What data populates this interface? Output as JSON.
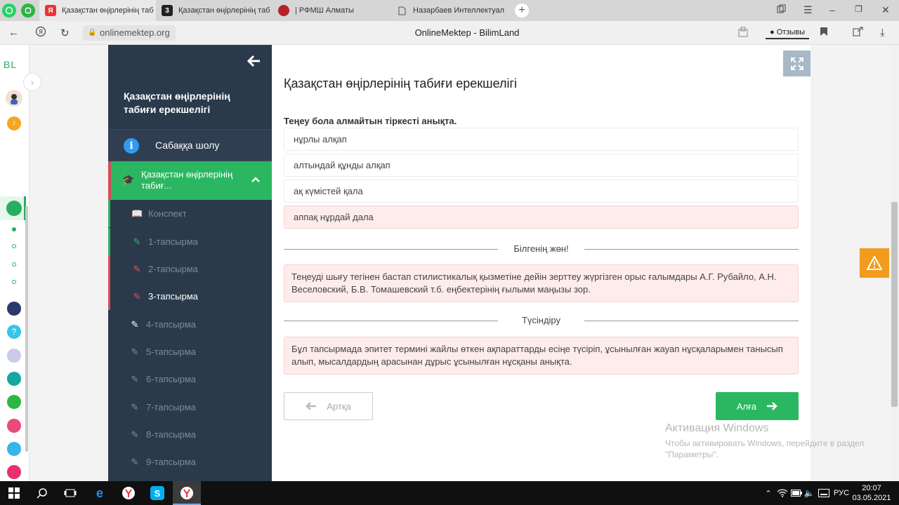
{
  "browser": {
    "tabs": [
      {
        "label": "Қазақстан өңірлерінің таб",
        "icon": "yandex-icon"
      },
      {
        "label": "Қазақстан өңірлерінің таб",
        "icon": "3-icon"
      },
      {
        "label": "| РФМШ Алматы",
        "icon": "rfmsh-icon"
      },
      {
        "label": "Назарбаев Интеллектуал",
        "icon": "page-icon"
      }
    ],
    "url": "onlinemektep.org",
    "page_title": "OnlineMektep - BilimLand",
    "feedback_label": "Отзывы"
  },
  "appbar": {
    "logo": "BL",
    "badge_count": "2"
  },
  "lesson_nav": {
    "title": "Қазақстан өңірлерінің табиғи ерекшелігі",
    "overview_label": "Сабаққа шолу",
    "section_label": "Қазақстан өңірлерінің табиғ...",
    "items": [
      {
        "label": "Конспект"
      },
      {
        "label": "1-тапсырма"
      },
      {
        "label": "2-тапсырма"
      },
      {
        "label": "3-тапсырма"
      },
      {
        "label": "4-тапсырма"
      },
      {
        "label": "5-тапсырма"
      },
      {
        "label": "6-тапсырма"
      },
      {
        "label": "7-тапсырма"
      },
      {
        "label": "8-тапсырма"
      },
      {
        "label": "9-тапсырма"
      }
    ]
  },
  "content": {
    "title": "Қазақстан өңірлерінің табиғи ерекшелігі",
    "question": "Теңеу бола алмайтын тіркесті анықта.",
    "options": [
      {
        "label": "нұрлы алқап"
      },
      {
        "label": "алтындай құнды алқап"
      },
      {
        "label": "ақ күмістей қала"
      },
      {
        "label": "аппақ нұрдай дала"
      }
    ],
    "knowledge_heading": "Білгенің жөн!",
    "knowledge_text": "Теңеуді шығу тегінен бастап стилистикалық қызметіне дейін зерттеу жүргізген орыс ғалымдары А.Г. Рубайло, А.Н. Веселовский, Б.В. Томашевский т.б. еңбектерінің ғылыми маңызы зор.",
    "explanation_heading": "Түсіндіру",
    "explanation_text": "Бұл тапсырмада эпитет термині жайлы өткен ақпараттарды есіңе түсіріп, ұсынылған жауап нұсқаларымен танысып алып, мысалдардың арасынан дұрыс ұсынылған нұсқаны анықта.",
    "back_label": "Артқа",
    "next_label": "Алға"
  },
  "watermark": {
    "title": "Активация Windows",
    "line1": "Чтобы активировать Windows, перейдите в раздел",
    "line2": "\"Параметры\"."
  },
  "taskbar": {
    "lang": "РУС",
    "time": "20:07",
    "date": "03.05.2021"
  }
}
